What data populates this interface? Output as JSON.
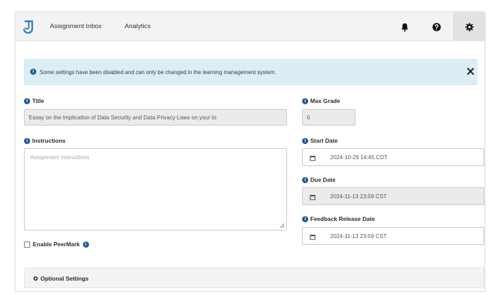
{
  "header": {
    "nav": [
      {
        "label": "Assignment Inbox"
      },
      {
        "label": "Analytics"
      }
    ],
    "icons": [
      "bell-icon",
      "help-icon",
      "gear-icon"
    ]
  },
  "alert": {
    "text": "Some settings have been disabled and can only be changed in the learning management system.",
    "close_glyph": "✕"
  },
  "form": {
    "title": {
      "label": "Title",
      "value": "Essay on the Implication of Data Security and Data Privacy Laws on your to"
    },
    "instructions": {
      "label": "Instructions",
      "placeholder": "Assignment instructions"
    },
    "max_grade": {
      "label": "Max Grade",
      "value": "0"
    },
    "start_date": {
      "label": "Start Date",
      "value": "2024-10-29 14:45 CDT"
    },
    "due_date": {
      "label": "Due Date",
      "value": "2024-11-13 23:59 CST"
    },
    "feedback_release_date": {
      "label": "Feedback Release Date",
      "value": "2024-11-13 23:59 CST"
    },
    "peermark": {
      "label": "Enable PeerMark",
      "checked": false
    }
  },
  "optional_settings": {
    "label": "Optional Settings"
  },
  "colors": {
    "accent": "#1f5d96",
    "alert_bg": "#dbeef4",
    "header_bg": "#f3f3f3"
  }
}
